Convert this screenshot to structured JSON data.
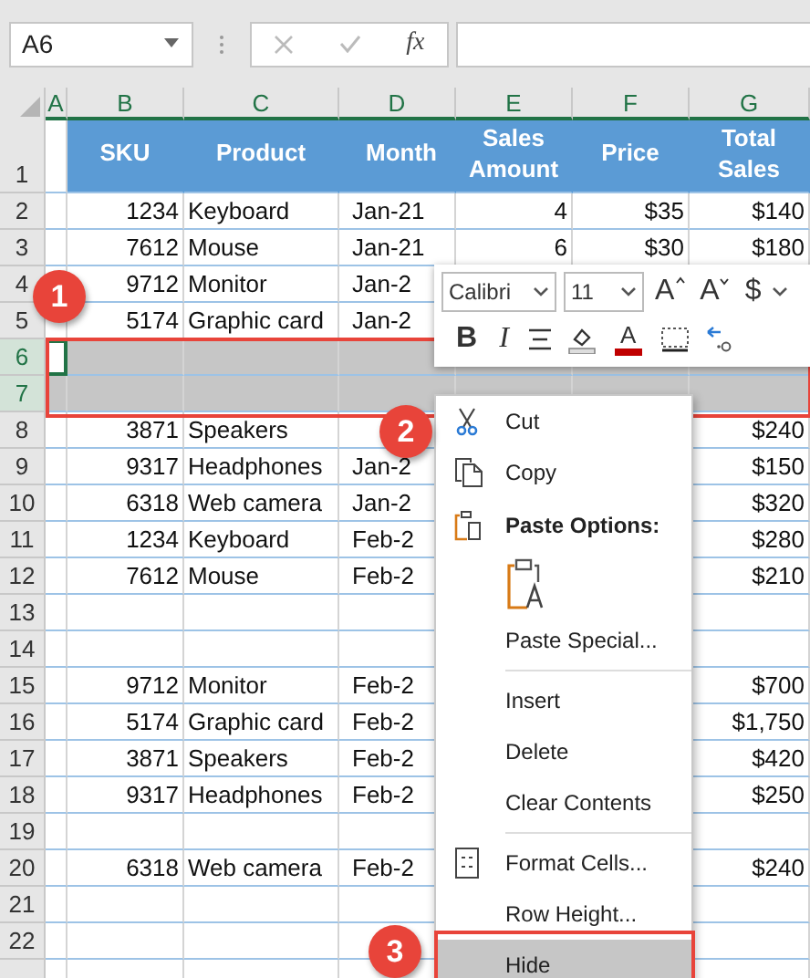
{
  "formula_bar": {
    "name_box": "A6",
    "fx": "fx"
  },
  "columns": [
    "A",
    "B",
    "C",
    "D",
    "E",
    "F",
    "G"
  ],
  "rows": [
    {
      "header": "1",
      "kind": "header",
      "selected": false,
      "active": false,
      "cells": [
        null,
        "SKU",
        "Product",
        "Month",
        "Sales Amount",
        "Price",
        "Total Sales"
      ]
    },
    {
      "header": "2",
      "kind": "data",
      "selected": false,
      "active": false,
      "cells": [
        null,
        "1234",
        "Keyboard",
        "Jan-21",
        "4",
        "$35",
        "$140"
      ]
    },
    {
      "header": "3",
      "kind": "data",
      "selected": false,
      "active": false,
      "cells": [
        null,
        "7612",
        "Mouse",
        "Jan-21",
        "6",
        "$30",
        "$180"
      ]
    },
    {
      "header": "4",
      "kind": "data",
      "selected": false,
      "active": false,
      "cells": [
        null,
        "9712",
        "Monitor",
        "Jan-2"
      ]
    },
    {
      "header": "5",
      "kind": "data",
      "selected": false,
      "active": false,
      "cells": [
        null,
        "5174",
        "Graphic card",
        "Jan-2"
      ]
    },
    {
      "header": "6",
      "kind": "data",
      "selected": true,
      "active": true,
      "cells": [
        null,
        null,
        null,
        null,
        null,
        null,
        null
      ]
    },
    {
      "header": "7",
      "kind": "data",
      "selected": true,
      "active": false,
      "cells": [
        null,
        null,
        null,
        null,
        null,
        null,
        null
      ]
    },
    {
      "header": "8",
      "kind": "data",
      "selected": false,
      "active": false,
      "cells": [
        null,
        "3871",
        "Speakers",
        null,
        null,
        null,
        "$240"
      ]
    },
    {
      "header": "9",
      "kind": "data",
      "selected": false,
      "active": false,
      "cells": [
        null,
        "9317",
        "Headphones",
        "Jan-2",
        null,
        null,
        "$150"
      ]
    },
    {
      "header": "10",
      "kind": "data",
      "selected": false,
      "active": false,
      "cells": [
        null,
        "6318",
        "Web camera",
        "Jan-2",
        null,
        null,
        "$320"
      ]
    },
    {
      "header": "11",
      "kind": "data",
      "selected": false,
      "active": false,
      "cells": [
        null,
        "1234",
        "Keyboard",
        "Feb-2",
        null,
        null,
        "$280"
      ]
    },
    {
      "header": "12",
      "kind": "data",
      "selected": false,
      "active": false,
      "cells": [
        null,
        "7612",
        "Mouse",
        "Feb-2",
        null,
        null,
        "$210"
      ]
    },
    {
      "header": "13",
      "kind": "data",
      "selected": false,
      "active": false,
      "cells": [
        null,
        null,
        null,
        null,
        null,
        null,
        null
      ]
    },
    {
      "header": "14",
      "kind": "data",
      "selected": false,
      "active": false,
      "cells": [
        null,
        null,
        null,
        null,
        null,
        null,
        null
      ]
    },
    {
      "header": "15",
      "kind": "data",
      "selected": false,
      "active": false,
      "cells": [
        null,
        "9712",
        "Monitor",
        "Feb-2",
        null,
        null,
        "$700"
      ]
    },
    {
      "header": "16",
      "kind": "data",
      "selected": false,
      "active": false,
      "cells": [
        null,
        "5174",
        "Graphic card",
        "Feb-2",
        null,
        null,
        "$1,750"
      ]
    },
    {
      "header": "17",
      "kind": "data",
      "selected": false,
      "active": false,
      "cells": [
        null,
        "3871",
        "Speakers",
        "Feb-2",
        null,
        null,
        "$420"
      ]
    },
    {
      "header": "18",
      "kind": "data",
      "selected": false,
      "active": false,
      "cells": [
        null,
        "9317",
        "Headphones",
        "Feb-2",
        null,
        null,
        "$250"
      ]
    },
    {
      "header": "19",
      "kind": "data",
      "selected": false,
      "active": false,
      "cells": [
        null,
        null,
        null,
        null,
        null,
        null,
        null
      ]
    },
    {
      "header": "20",
      "kind": "data",
      "selected": false,
      "active": false,
      "cells": [
        null,
        "6318",
        "Web camera",
        "Feb-2",
        null,
        null,
        "$240"
      ]
    },
    {
      "header": "21",
      "kind": "data",
      "selected": false,
      "active": false,
      "cells": [
        null,
        null,
        null,
        null,
        null,
        null,
        null
      ]
    },
    {
      "header": "22",
      "kind": "data",
      "selected": false,
      "active": false,
      "cells": [
        null,
        null,
        null,
        null,
        null,
        null,
        null
      ]
    }
  ],
  "mini_toolbar": {
    "font": "Calibri",
    "size": "11",
    "row1": [
      {
        "kind": "grow",
        "label": "A"
      },
      {
        "kind": "shrink",
        "label": "A"
      },
      {
        "kind": "currency",
        "label": "$"
      }
    ],
    "row2": [
      {
        "kind": "bold",
        "label": "B"
      },
      {
        "kind": "italic",
        "label": "I"
      },
      {
        "kind": "align"
      },
      {
        "kind": "fill"
      },
      {
        "kind": "font_color",
        "label": "A"
      },
      {
        "kind": "borders"
      },
      {
        "kind": "decimal"
      }
    ]
  },
  "context_menu": [
    {
      "kind": "cut",
      "label": "Cut",
      "selected": false
    },
    {
      "kind": "copy",
      "label": "Copy",
      "selected": false
    },
    {
      "kind": "paste_header",
      "label": "Paste Options:"
    },
    {
      "kind": "paste_button"
    },
    {
      "kind": "command",
      "label": "Paste Special...",
      "selected": false
    },
    {
      "kind": "separator"
    },
    {
      "kind": "command",
      "label": "Insert",
      "selected": false
    },
    {
      "kind": "command",
      "label": "Delete",
      "selected": false
    },
    {
      "kind": "command",
      "label": "Clear Contents",
      "selected": false
    },
    {
      "kind": "separator"
    },
    {
      "kind": "format_cells",
      "label": "Format Cells...",
      "selected": false
    },
    {
      "kind": "command",
      "label": "Row Height...",
      "selected": false
    },
    {
      "kind": "command",
      "label": "Hide",
      "selected": true
    }
  ],
  "callouts": [
    {
      "label": "1"
    },
    {
      "label": "2"
    },
    {
      "label": "3"
    }
  ]
}
